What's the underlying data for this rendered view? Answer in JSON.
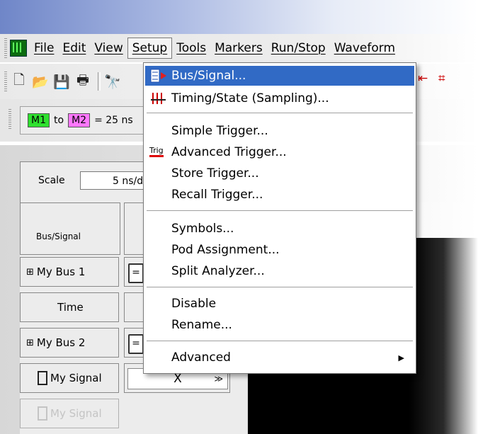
{
  "menubar": {
    "items": [
      "File",
      "Edit",
      "View",
      "Setup",
      "Tools",
      "Markers",
      "Run/Stop",
      "Waveform"
    ]
  },
  "markers": {
    "m1": "M1",
    "to": "to",
    "m2": "M2",
    "readout": "= 25 ns"
  },
  "scale": {
    "label": "Scale",
    "value": "5 ns/di"
  },
  "grid": {
    "header": "Bus/Signal",
    "rows": [
      "My Bus 1",
      "Time",
      "My Bus 2",
      "My Signal",
      "My Signal"
    ],
    "eq": "=",
    "select_value": "X"
  },
  "setup_menu": {
    "items": [
      "Bus/Signal...",
      "Timing/State (Sampling)...",
      "Simple Trigger...",
      "Advanced Trigger...",
      "Store Trigger...",
      "Recall Trigger...",
      "Symbols...",
      "Pod Assignment...",
      "Split Analyzer...",
      "Disable",
      "Rename...",
      "Advanced"
    ],
    "trig_icon_text": "Trig",
    "selected_index": 0
  },
  "colors": {
    "selection": "#316ac5",
    "marker1": "#2ee02e",
    "marker2": "#ff77ff"
  }
}
